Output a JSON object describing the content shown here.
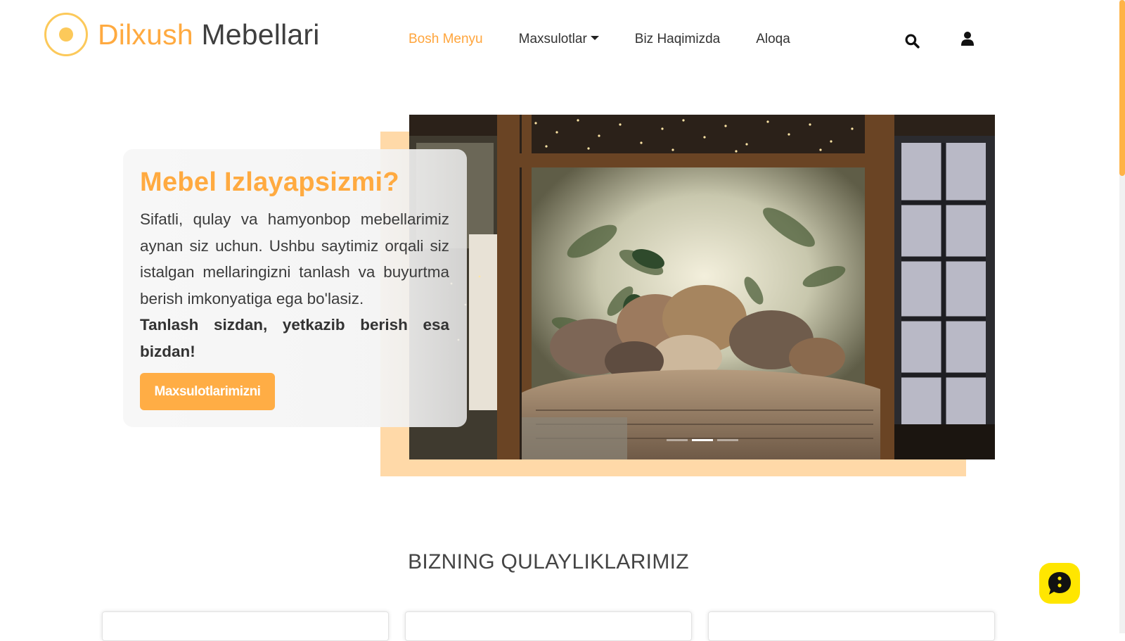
{
  "brand": {
    "name_part1": "Dilxush",
    "name_part2": "Mebellari",
    "color_primary": "#ffaa40"
  },
  "nav": {
    "items": [
      {
        "label": "Bosh Menyu",
        "active": true
      },
      {
        "label": "Maxsulotlar",
        "dropdown": true
      },
      {
        "label": "Biz Haqimizda"
      },
      {
        "label": "Aloqa"
      }
    ],
    "icons": [
      "search-icon",
      "user-icon"
    ]
  },
  "hero": {
    "title": "Mebel Izlayapsizmi?",
    "text": "Sifatli, qulay va hamyonbop mebellarimiz aynan siz uchun. Ushbu saytimiz orqali siz istalgan mellaringizni tanlash va buyurtma berish imkonyatiga ega bo'lasiz.",
    "strong": "Tanlash sizdan, yetkazib berish esa bizdan!",
    "button": "Maxsulotlarimizni",
    "carousel_active_index": 1,
    "carousel_count": 3
  },
  "section": {
    "title": "BIZNING QULAYLIKLARIMIZ"
  },
  "chat": {
    "icon": "chat-icon",
    "color": "#ffe600"
  }
}
